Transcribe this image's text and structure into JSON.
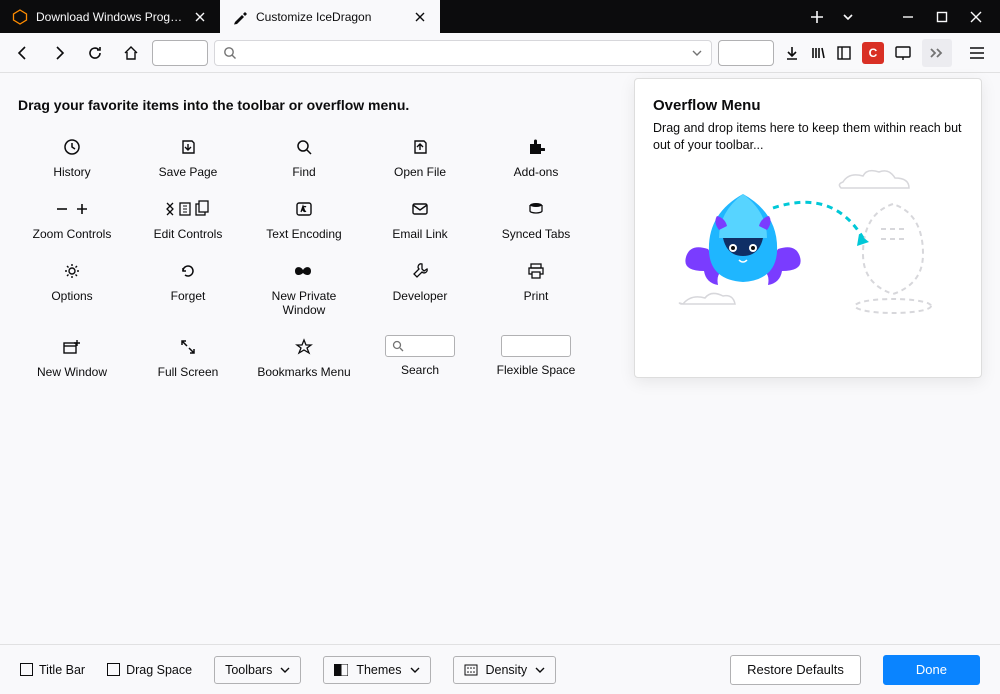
{
  "tabs": [
    {
      "title": "Download Windows Programs",
      "active": false
    },
    {
      "title": "Customize IceDragon",
      "active": true
    }
  ],
  "navbar": {
    "search_placeholder": ""
  },
  "customize": {
    "instruction": "Drag your favorite items into the toolbar or overflow menu.",
    "items": {
      "history": "History",
      "save_page": "Save Page",
      "find": "Find",
      "open_file": "Open File",
      "addons": "Add-ons",
      "zoom": "Zoom Controls",
      "edit": "Edit Controls",
      "encoding": "Text Encoding",
      "email": "Email Link",
      "synced": "Synced Tabs",
      "options": "Options",
      "forget": "Forget",
      "private": "New Private Window",
      "developer": "Developer",
      "print": "Print",
      "newwindow": "New Window",
      "fullscreen": "Full Screen",
      "bookmarks": "Bookmarks Menu",
      "search": "Search",
      "flex": "Flexible Space"
    }
  },
  "overflow": {
    "title": "Overflow Menu",
    "desc": "Drag and drop items here to keep them within reach but out of your toolbar..."
  },
  "footer": {
    "titlebar": "Title Bar",
    "dragspace": "Drag Space",
    "toolbars": "Toolbars",
    "themes": "Themes",
    "density": "Density",
    "restore": "Restore Defaults",
    "done": "Done"
  }
}
